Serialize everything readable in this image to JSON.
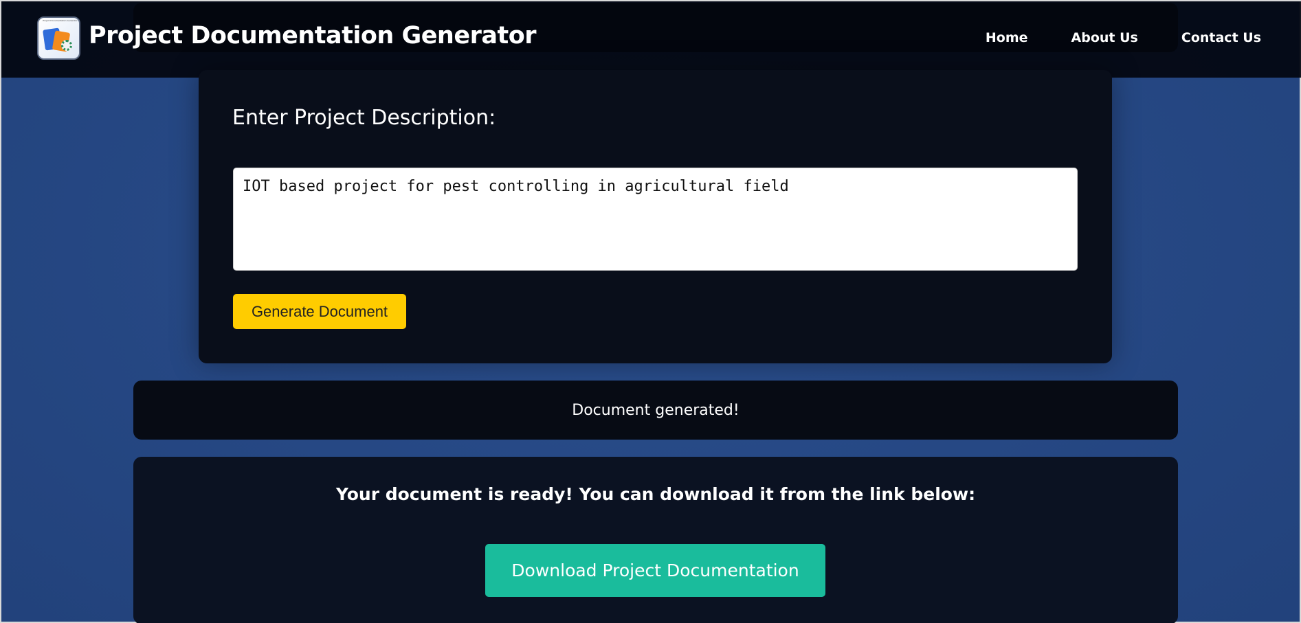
{
  "header": {
    "title": "Project Documentation Generator",
    "logo_caption": "Project Documentation Generator",
    "nav": [
      {
        "label": "Home"
      },
      {
        "label": "About Us"
      },
      {
        "label": "Contact Us"
      }
    ]
  },
  "form": {
    "label": "Enter Project Description:",
    "description_value": "IOT based project for pest controlling in agricultural field",
    "generate_button": "Generate Document"
  },
  "status": {
    "message": "Document generated!"
  },
  "download": {
    "ready_message": "Your document is ready! You can download it from the link below:",
    "button_label": "Download Project Documentation"
  },
  "colors": {
    "page_background": "#2a4e8d",
    "header_background": "#03070f",
    "card_background": "#090e1a",
    "generate_button": "#ffcc00",
    "download_button": "#1abc9c"
  },
  "icons": {
    "logo": "document-gear-logo-icon"
  }
}
